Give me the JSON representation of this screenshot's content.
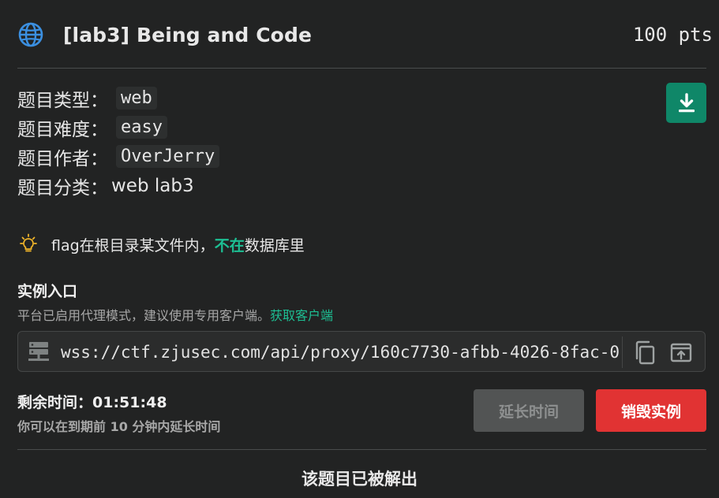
{
  "challenge": {
    "title": "[lab3] Being and Code",
    "points": "100 pts"
  },
  "meta": {
    "type_label": "题目类型：",
    "type_value": "web",
    "difficulty_label": "题目难度：",
    "difficulty_value": "easy",
    "author_label": "题目作者：",
    "author_value": "OverJerry",
    "category_label": "题目分类：",
    "category_value": "web lab3"
  },
  "hint": {
    "before": "flag在根目录某文件内，",
    "highlight": "不在",
    "after": "数据库里"
  },
  "instance": {
    "title": "实例入口",
    "description": "平台已启用代理模式，建议使用专用客户端。",
    "client_link": "获取客户端",
    "url": "wss://ctf.zjusec.com/api/proxy/160c7730-afbb-4026-8fac-0"
  },
  "timer": {
    "label": "剩余时间：",
    "remaining": "01:51:48",
    "hint": "你可以在到期前 10 分钟内延长时间"
  },
  "buttons": {
    "extend": "延长时间",
    "destroy": "销毁实例"
  },
  "status": {
    "solved": "该题目已被解出"
  },
  "colors": {
    "background": "#222323",
    "accent": "#1dbf93",
    "download": "#0f8768",
    "destroy": "#e13333",
    "extend_disabled": "#525454",
    "globe": "#3b8fe0",
    "bulb": "#f0b429"
  },
  "icons": [
    "globe-icon",
    "download-icon",
    "lightbulb-icon",
    "server-icon",
    "copy-icon",
    "open-in-new-icon"
  ]
}
